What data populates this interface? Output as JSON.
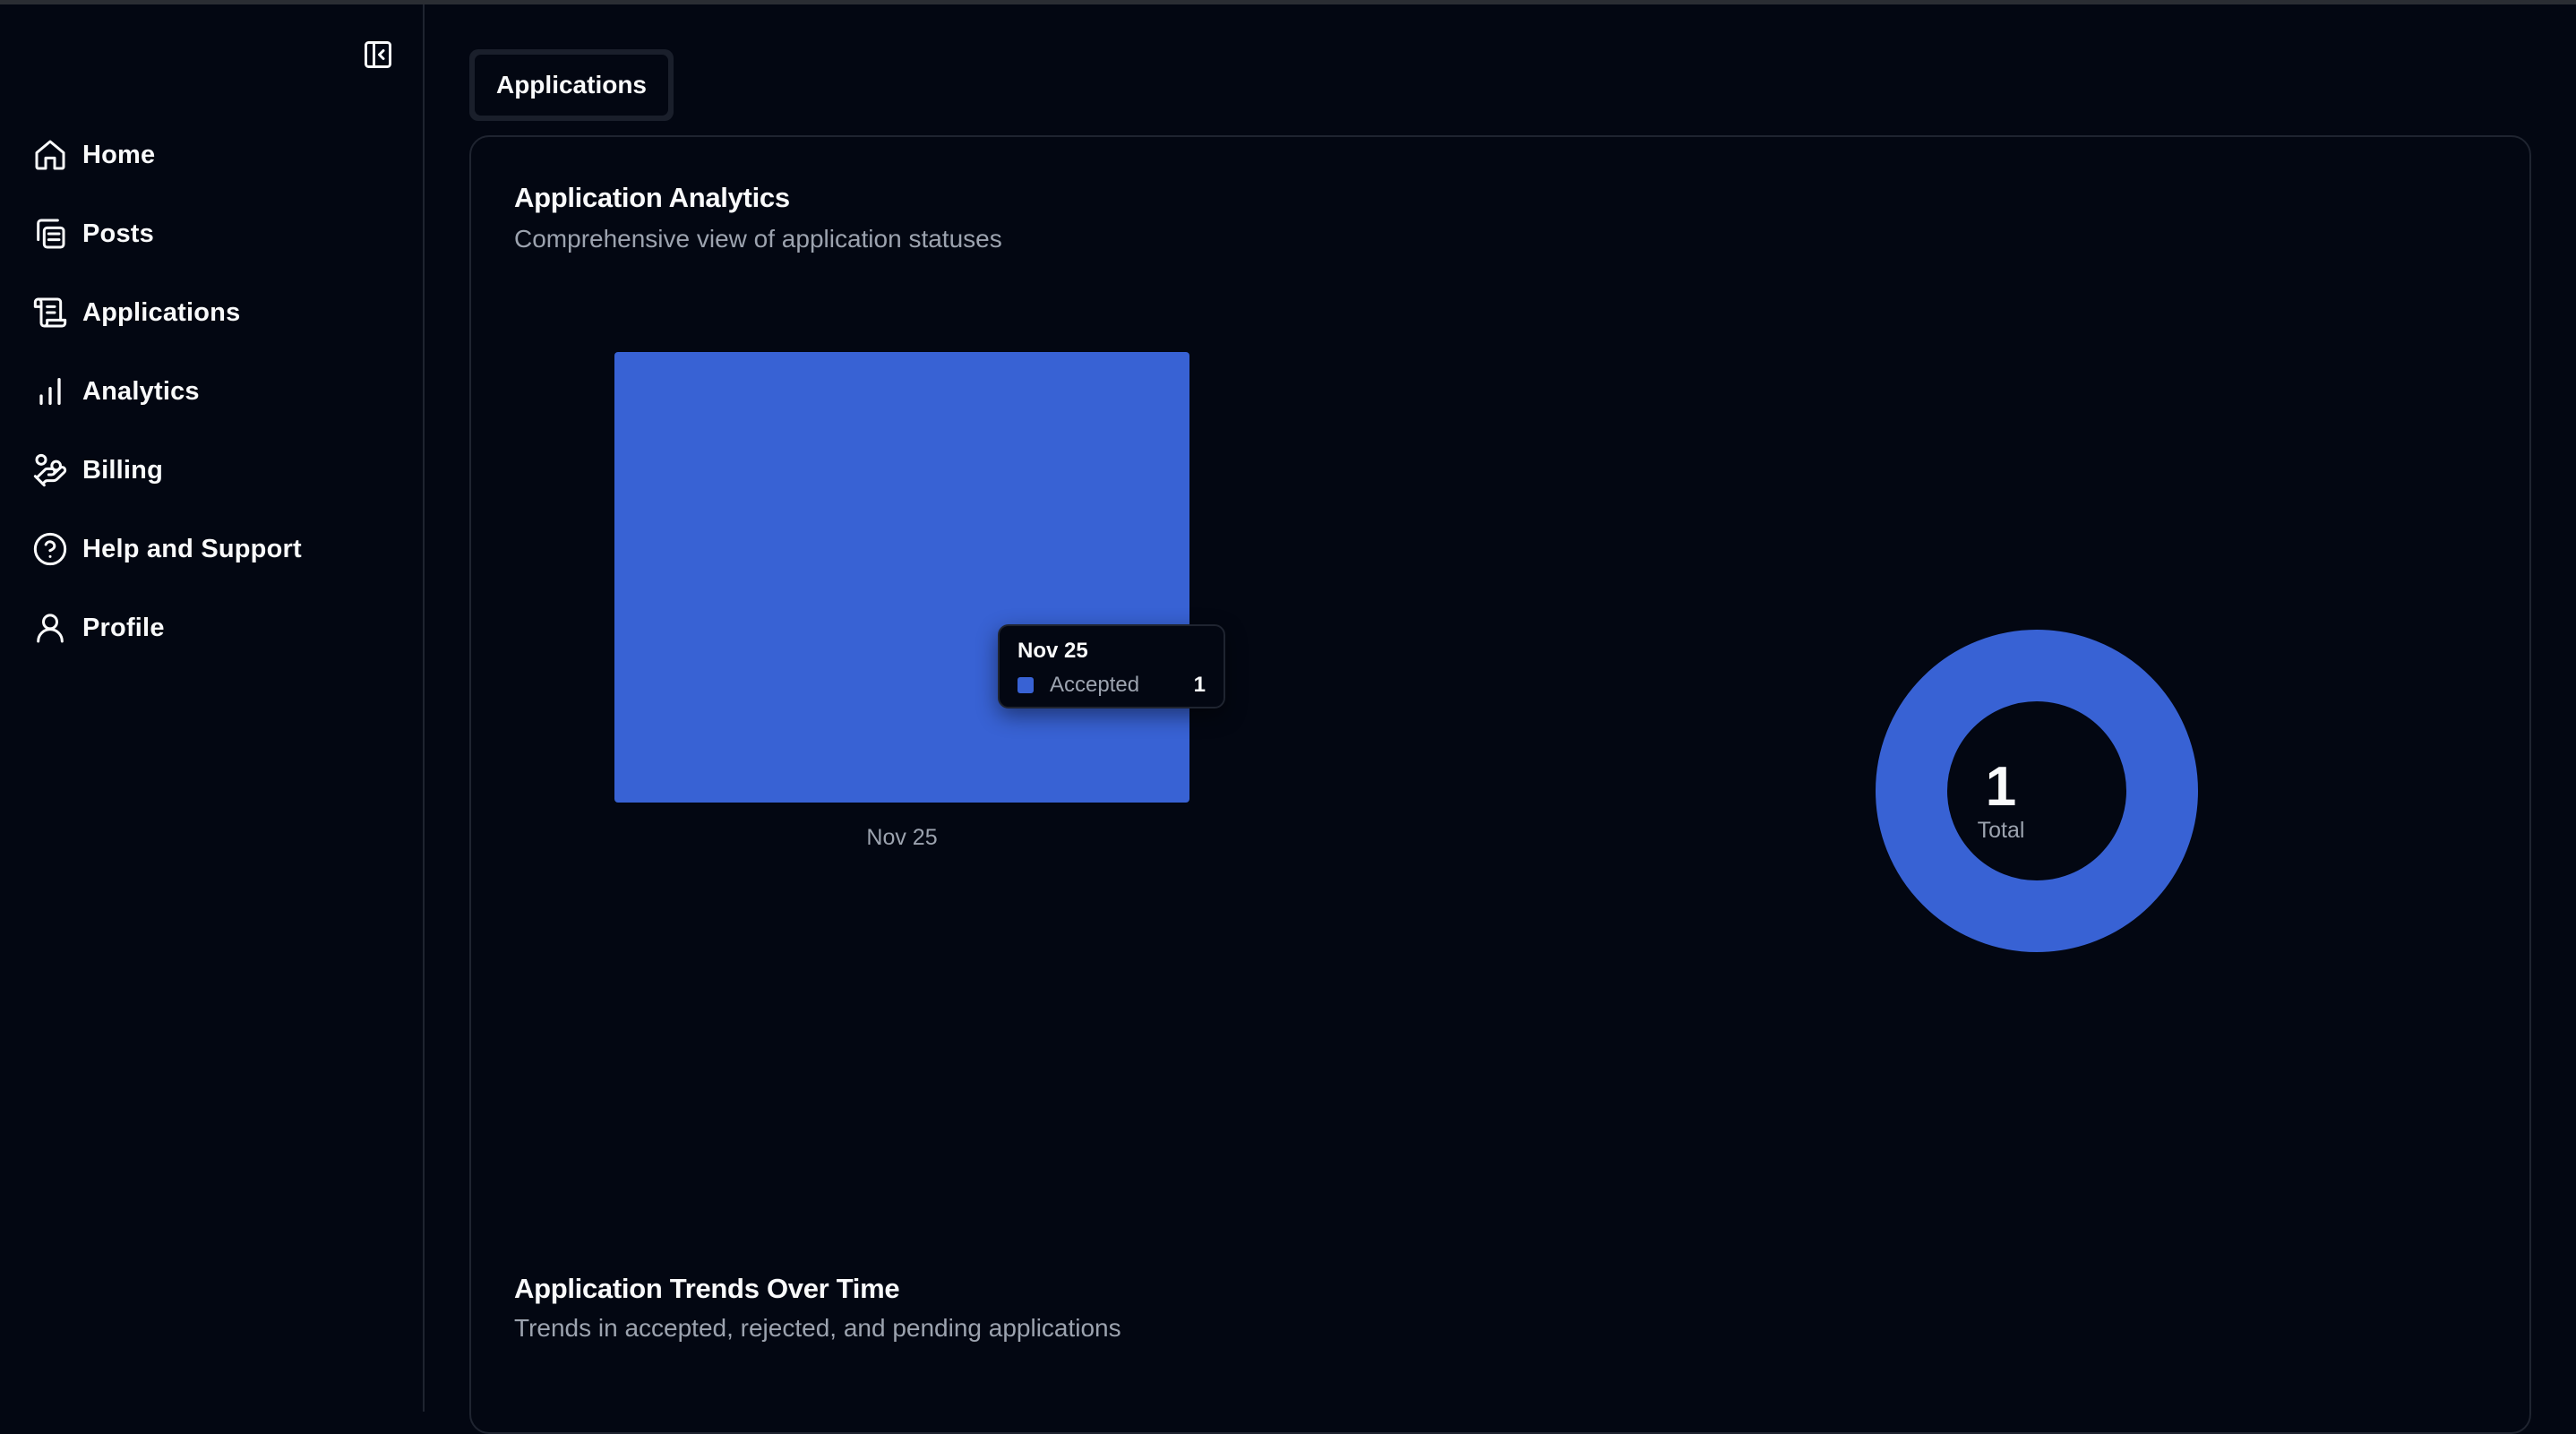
{
  "sidebar": {
    "collapse_icon": "panel-left-close-icon",
    "items": [
      {
        "label": "Home",
        "icon": "home-icon"
      },
      {
        "label": "Posts",
        "icon": "copy-icon"
      },
      {
        "label": "Applications",
        "icon": "scroll-icon"
      },
      {
        "label": "Analytics",
        "icon": "bar-chart-icon"
      },
      {
        "label": "Billing",
        "icon": "hand-coins-icon"
      },
      {
        "label": "Help and Support",
        "icon": "help-circle-icon"
      },
      {
        "label": "Profile",
        "icon": "user-icon"
      }
    ]
  },
  "tabs": [
    {
      "label": "Applications",
      "active": true
    }
  ],
  "analytics": {
    "title": "Application Analytics",
    "description": "Comprehensive view of application statuses"
  },
  "tooltip": {
    "date": "Nov 25",
    "series_label": "Accepted",
    "value": "1"
  },
  "donut": {
    "total": "1",
    "label": "Total"
  },
  "trends": {
    "title": "Application Trends Over Time",
    "description": "Trends in accepted, rejected, and pending applications"
  },
  "colors": {
    "accent": "#3862d4",
    "background": "#030712",
    "border": "#1f2430",
    "muted_text": "#9ca3af"
  },
  "chart_data": [
    {
      "type": "bar",
      "categories": [
        "Nov 25"
      ],
      "series": [
        {
          "name": "Accepted",
          "values": [
            1
          ]
        }
      ],
      "ylim": [
        0,
        1
      ],
      "grid": false
    },
    {
      "type": "pie",
      "labels": [
        "Accepted"
      ],
      "values": [
        1
      ],
      "center_text": "1",
      "center_label": "Total"
    }
  ]
}
